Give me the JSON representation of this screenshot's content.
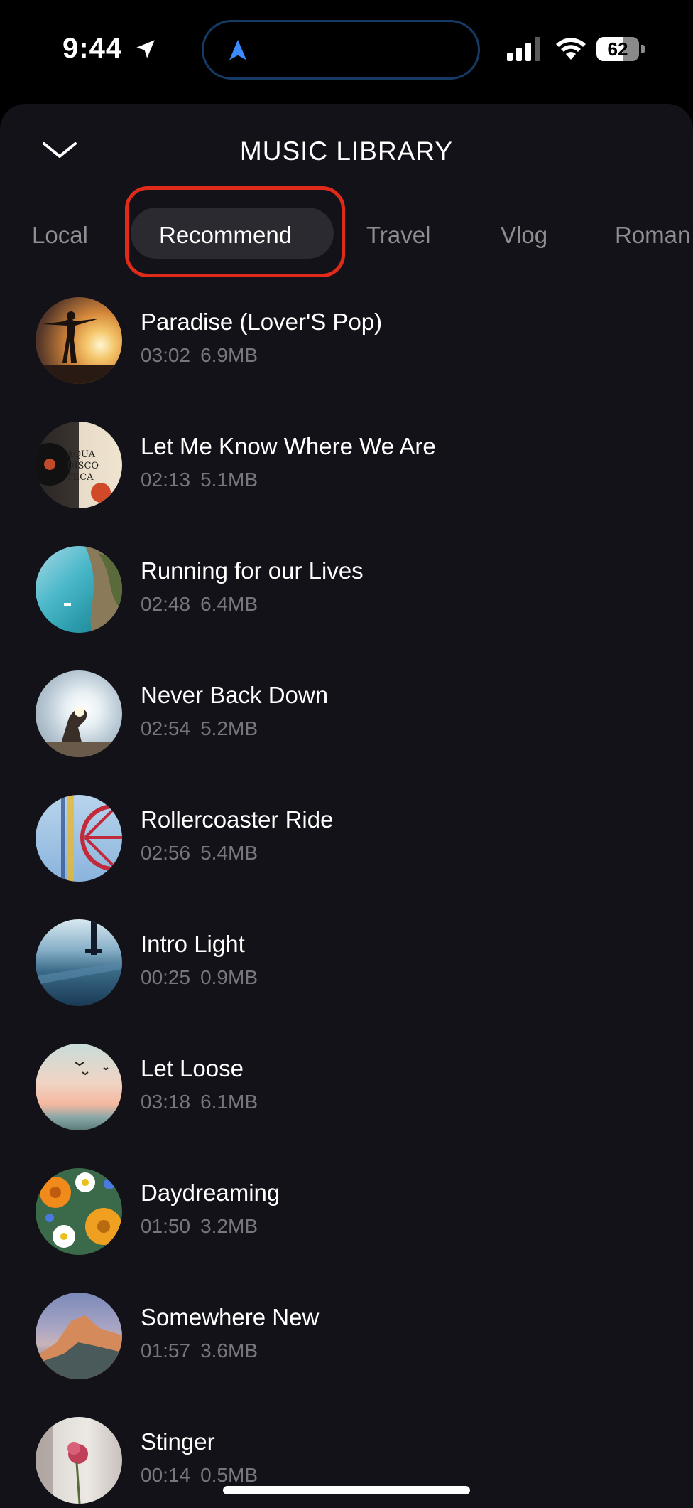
{
  "status_bar": {
    "time": "9:44",
    "battery": "62"
  },
  "header": {
    "title": "MUSIC LIBRARY"
  },
  "tabs": [
    {
      "label": "Local",
      "active": false
    },
    {
      "label": "Recommend",
      "active": true
    },
    {
      "label": "Travel",
      "active": false
    },
    {
      "label": "Vlog",
      "active": false
    },
    {
      "label": "Roman",
      "active": false
    }
  ],
  "songs": [
    {
      "title": " Paradise (Lover'S Pop)",
      "duration": "03:02",
      "size": "6.9MB"
    },
    {
      "title": "Let Me Know Where We Are",
      "duration": "02:13",
      "size": "5.1MB"
    },
    {
      "title": "Running for our Lives",
      "duration": "02:48",
      "size": "6.4MB"
    },
    {
      "title": "Never Back Down",
      "duration": "02:54",
      "size": "5.2MB"
    },
    {
      "title": "Rollercoaster Ride",
      "duration": "02:56",
      "size": "5.4MB"
    },
    {
      "title": "Intro Light",
      "duration": "00:25",
      "size": "0.9MB"
    },
    {
      "title": "Let Loose",
      "duration": "03:18",
      "size": "6.1MB"
    },
    {
      "title": "Daydreaming",
      "duration": "01:50",
      "size": "3.2MB"
    },
    {
      "title": "Somewhere New",
      "duration": "01:57",
      "size": "3.6MB"
    },
    {
      "title": "Stinger",
      "duration": "00:14",
      "size": "0.5MB"
    }
  ],
  "colors": {
    "accent_highlight": "#e02a1a",
    "background": "#131218",
    "nav_icon": "#3b8cff"
  }
}
